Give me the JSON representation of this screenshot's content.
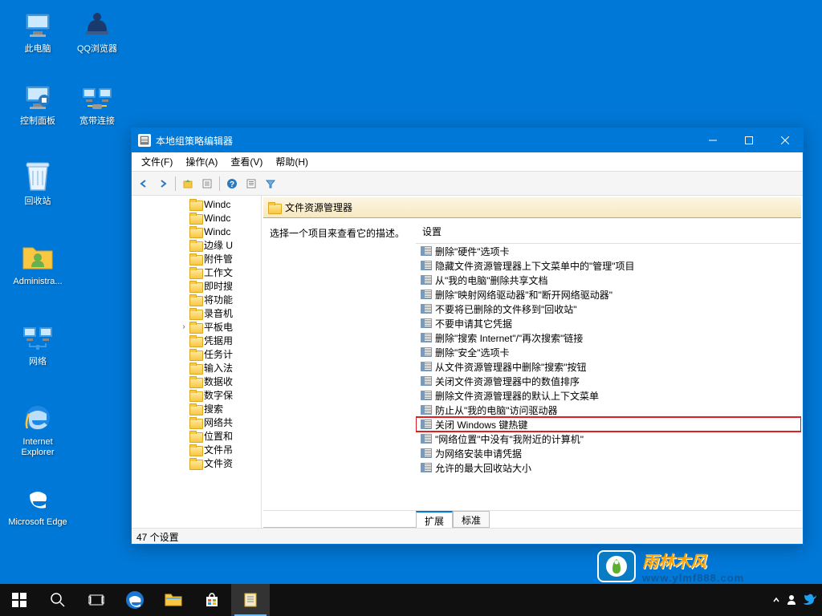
{
  "desktop": {
    "icons": [
      {
        "label": "此电脑"
      },
      {
        "label": "QQ浏览器"
      },
      {
        "label": "控制面板"
      },
      {
        "label": "宽带连接"
      },
      {
        "label": "回收站"
      },
      {
        "label": "Administra..."
      },
      {
        "label": "网络"
      },
      {
        "label": "Internet Explorer"
      },
      {
        "label": "Microsoft Edge"
      }
    ]
  },
  "window": {
    "title": "本地组策略编辑器",
    "menus": [
      "文件(F)",
      "操作(A)",
      "查看(V)",
      "帮助(H)"
    ],
    "tree_items": [
      "Windc",
      "Windc",
      "Windc",
      "边缘 U",
      "附件管",
      "工作文",
      "即时搜",
      "将功能",
      "录音机",
      "平板电",
      "凭据用",
      "任务计",
      "输入法",
      "数据收",
      "数字保",
      "搜索",
      "网络共",
      "位置和",
      "文件吊",
      "文件资"
    ],
    "tree_expand_item_index": 9,
    "content_header": "文件资源管理器",
    "desc_hint": "选择一个项目来查看它的描述。",
    "settings_header": "设置",
    "settings": [
      "删除\"硬件\"选项卡",
      "隐藏文件资源管理器上下文菜单中的\"管理\"项目",
      "从\"我的电脑\"删除共享文档",
      "删除\"映射网络驱动器\"和\"断开网络驱动器\"",
      "不要将已删除的文件移到\"回收站\"",
      "不要申请其它凭据",
      "删除\"搜索 Internet\"/\"再次搜索\"链接",
      "删除\"安全\"选项卡",
      "从文件资源管理器中删除\"搜索\"按钮",
      "关闭文件资源管理器中的数值排序",
      "删除文件资源管理器的默认上下文菜单",
      "防止从\"我的电脑\"访问驱动器",
      "关闭 Windows 键热键",
      "\"网络位置\"中没有\"我附近的计算机\"",
      "为网络安装申请凭据",
      "允许的最大回收站大小"
    ],
    "highlighted_setting_index": 12,
    "tabs": [
      "扩展",
      "标准"
    ],
    "active_tab_index": 0,
    "status": "47 个设置"
  },
  "watermark": {
    "cn": "雨林木风",
    "url": "www.ylmf888.com"
  }
}
